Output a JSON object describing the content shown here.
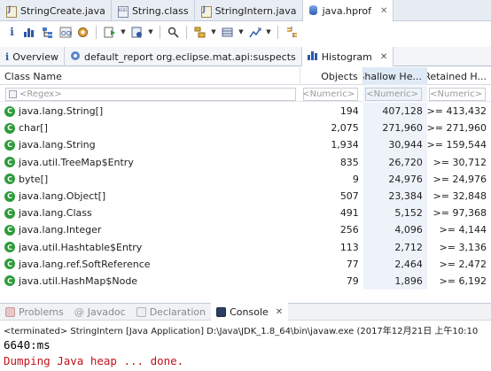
{
  "editor_tabs": [
    {
      "label": "StringCreate.java",
      "icon": "java-file-icon"
    },
    {
      "label": "String.class",
      "icon": "class-file-icon"
    },
    {
      "label": "StringIntern.java",
      "icon": "java-file-icon"
    },
    {
      "label": "java.hprof",
      "icon": "heap-dump-icon",
      "active": true,
      "close": "✕"
    }
  ],
  "result_tabs": {
    "overview": "Overview",
    "report": "default_report  org.eclipse.mat.api:suspects",
    "histogram": "Histogram",
    "close": "✕"
  },
  "table": {
    "headers": [
      "Class Name",
      "Objects",
      "Shallow He...",
      "Retained H..."
    ],
    "filters": [
      "<Regex>",
      "<Numeric>",
      "<Numeric>",
      "<Numeric>"
    ],
    "rows": [
      {
        "name": "java.lang.String[]",
        "objects": "194",
        "shallow": "407,128",
        "retained": ">= 413,432"
      },
      {
        "name": "char[]",
        "objects": "2,075",
        "shallow": "271,960",
        "retained": ">= 271,960"
      },
      {
        "name": "java.lang.String",
        "objects": "1,934",
        "shallow": "30,944",
        "retained": ">= 159,544"
      },
      {
        "name": "java.util.TreeMap$Entry",
        "objects": "835",
        "shallow": "26,720",
        "retained": ">= 30,712"
      },
      {
        "name": "byte[]",
        "objects": "9",
        "shallow": "24,976",
        "retained": ">= 24,976"
      },
      {
        "name": "java.lang.Object[]",
        "objects": "507",
        "shallow": "23,384",
        "retained": ">= 32,848"
      },
      {
        "name": "java.lang.Class",
        "objects": "491",
        "shallow": "5,152",
        "retained": ">= 97,368"
      },
      {
        "name": "java.lang.Integer",
        "objects": "256",
        "shallow": "4,096",
        "retained": ">= 4,144"
      },
      {
        "name": "java.util.Hashtable$Entry",
        "objects": "113",
        "shallow": "2,712",
        "retained": ">= 3,136"
      },
      {
        "name": "java.lang.ref.SoftReference",
        "objects": "77",
        "shallow": "2,464",
        "retained": ">= 2,472"
      },
      {
        "name": "java.util.HashMap$Node",
        "objects": "79",
        "shallow": "1,896",
        "retained": ">= 6,192"
      }
    ]
  },
  "bottom_tabs": {
    "problems": "Problems",
    "javadoc": "Javadoc",
    "declaration": "Declaration",
    "console": "Console",
    "close": "✕"
  },
  "console": {
    "terminated": "<terminated> StringIntern [Java Application] D:\\Java\\JDK_1.8_64\\bin\\javaw.exe (2017年12月21日 上午10:10",
    "line1": "6640:ms",
    "line2": "Dumping Java heap ... done."
  },
  "colors": {
    "class_icon": "#2e9b3b",
    "console_error": "#c0121b",
    "sorted_column": "#dfeaf7"
  }
}
